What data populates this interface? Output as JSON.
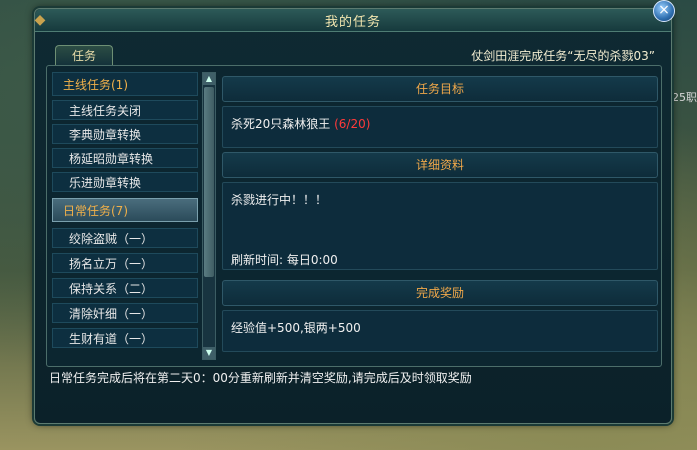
{
  "window": {
    "title": "我的任务",
    "close_icon": "×",
    "corner_icon": "◆"
  },
  "tab": {
    "label": "任务"
  },
  "notice": "仗剑田涯完成任务“无尽的杀戮03”",
  "side_text": "25职",
  "list": {
    "main_category": "主线任务(1)",
    "main_items": [
      "主线任务关闭",
      "李典勋章转换",
      "杨延昭勋章转换",
      "乐进勋章转换"
    ],
    "daily_category": "日常任务(7)",
    "daily_items": [
      "绞除盗贼（一）",
      "扬名立万（一）",
      "保持关系（二）",
      "清除奸细（一）",
      "生财有道（一）"
    ]
  },
  "scrollbar": {
    "up_icon": "▲",
    "down_icon": "▼"
  },
  "objective": {
    "header": "任务目标",
    "text": "杀死20只森林狼王",
    "progress": "(6/20)"
  },
  "details": {
    "header": "详细资料",
    "text": "杀戮进行中！！！",
    "refresh": "刷新时间: 每日0:00"
  },
  "reward": {
    "header": "完成奖励",
    "text": "经验值+500,银两+500"
  },
  "footer": "日常任务完成后将在第二天0：00分重新刷新并清空奖励,请完成后及时领取奖励",
  "colors": {
    "accent": "#f0a84a",
    "progress": "#ff3a3a",
    "title": "#f3e7b0"
  }
}
